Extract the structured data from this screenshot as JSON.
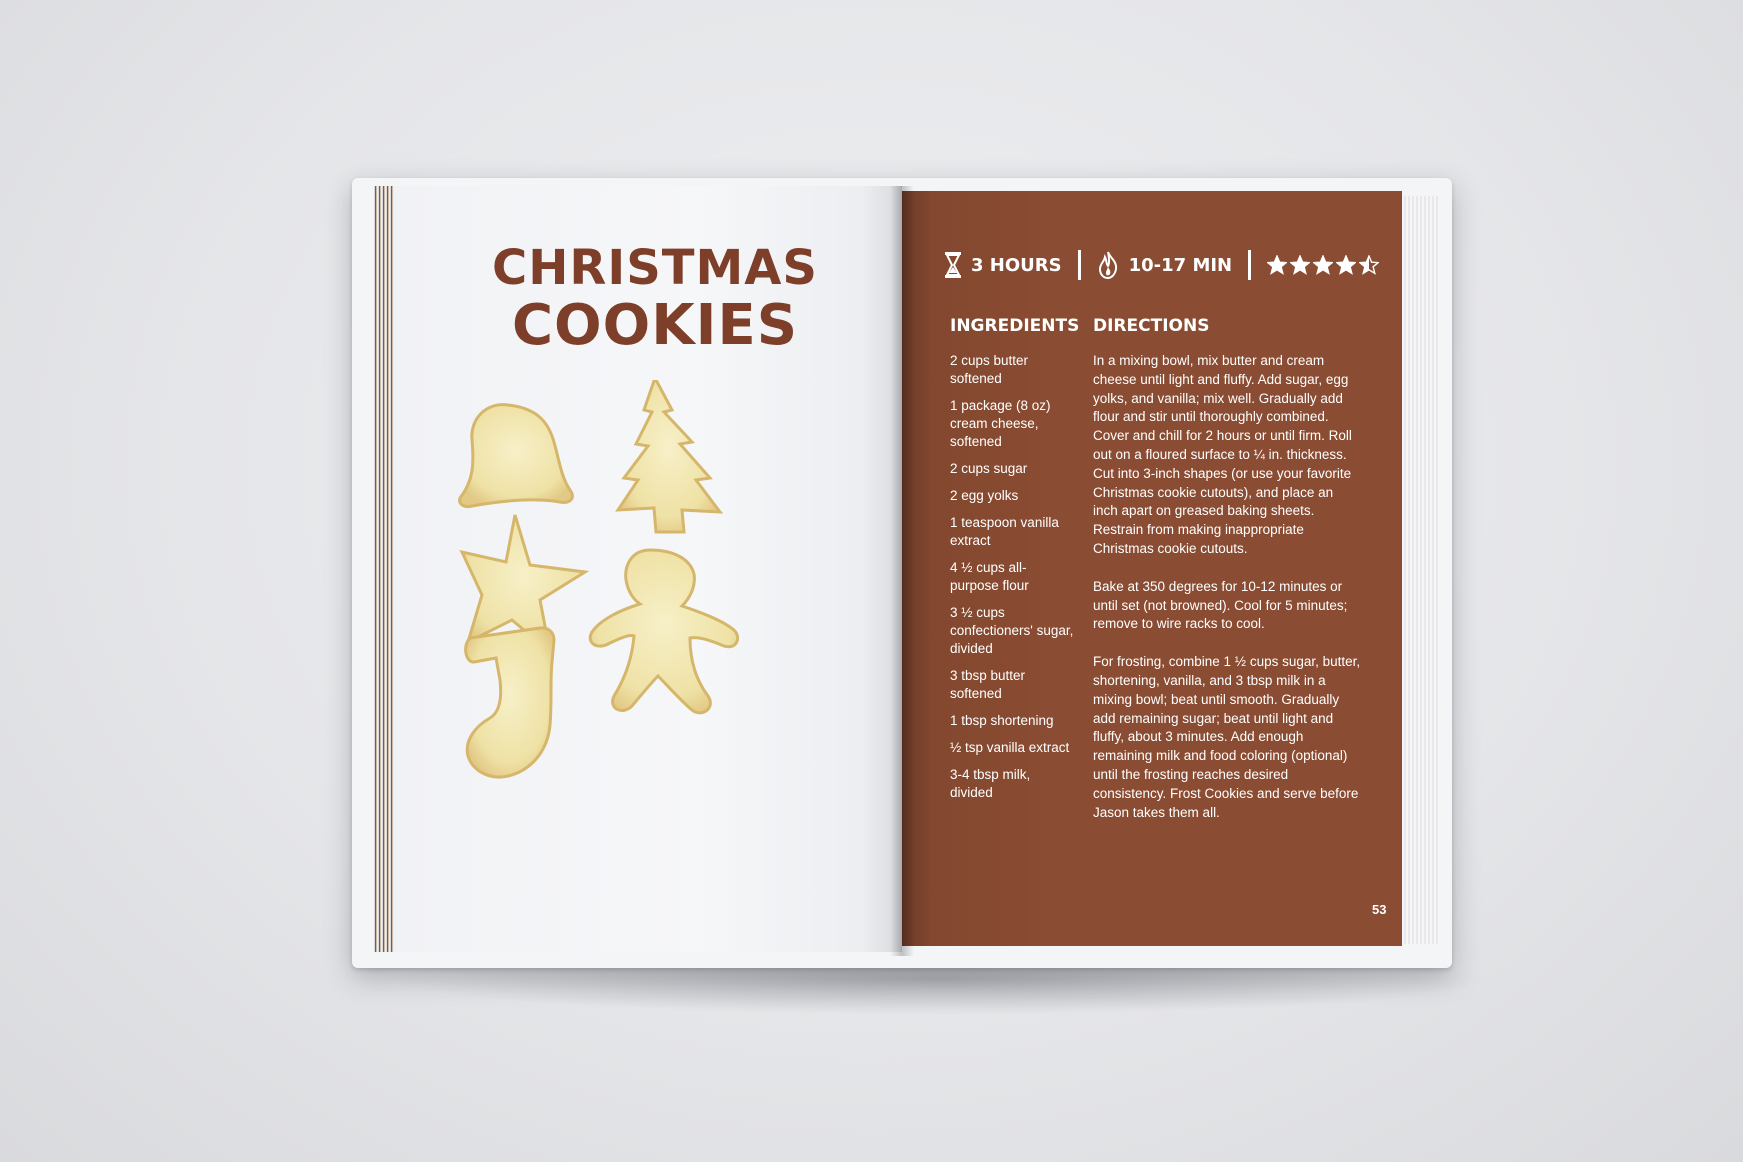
{
  "title": {
    "line1": "CHRISTMAS",
    "line2": "COOKIES"
  },
  "stats": {
    "time": "3 HOURS",
    "cook_time": "10-17 MIN",
    "rating": 4.5,
    "rating_max": 5,
    "time_icon": "hourglass-icon",
    "cook_icon": "flame-icon"
  },
  "ingredients": {
    "heading": "INGREDIENTS",
    "items": [
      "2 cups butter softened",
      "1 package (8 oz) cream cheese, softened",
      "2 cups sugar",
      "2 egg yolks",
      "1 teaspoon vanilla extract",
      "4 ½ cups all-purpose flour",
      "3 ½ cups confectioners' sugar, divided",
      "3 tbsp butter softened",
      "1 tbsp shortening",
      "½ tsp vanilla extract",
      "3-4 tbsp milk, divided"
    ]
  },
  "directions": {
    "heading": "DIRECTIONS",
    "paragraphs": [
      "In a mixing bowl, mix butter and cream cheese until light and fluffy. Add sugar, egg yolks, and vanilla; mix well. Gradually add flour and stir until thoroughly combined. Cover and chill for 2 hours or until firm. Roll out on a floured surface to ¼ in. thickness. Cut into 3-inch shapes (or use your favorite Christmas cookie cutouts), and place an inch apart on greased baking sheets. Restrain from making inappropriate Christmas cookie cutouts.",
      "Bake at 350 degrees for 10-12 minutes or until set (not browned). Cool for 5 minutes; remove to wire racks to cool.",
      "For frosting, combine 1 ½ cups sugar, butter, shortening, vanilla, and 3 tbsp milk in a mixing bowl; beat until smooth. Gradually add remaining sugar; beat until light and fluffy, about 3 minutes. Add enough remaining milk and food coloring (optional) until the frosting reaches desired consistency. Frost Cookies and serve before Jason takes them all."
    ]
  },
  "page_number": "53",
  "colors": {
    "page_brown": "#8a4c32",
    "title_brown": "#7d3f29",
    "cookie_fill": "#f3eab8",
    "cookie_edge": "#d7b76e"
  },
  "cookies": [
    "bell-cookie",
    "tree-cookie",
    "star-cookie",
    "gingerbread-cookie",
    "stocking-cookie"
  ]
}
